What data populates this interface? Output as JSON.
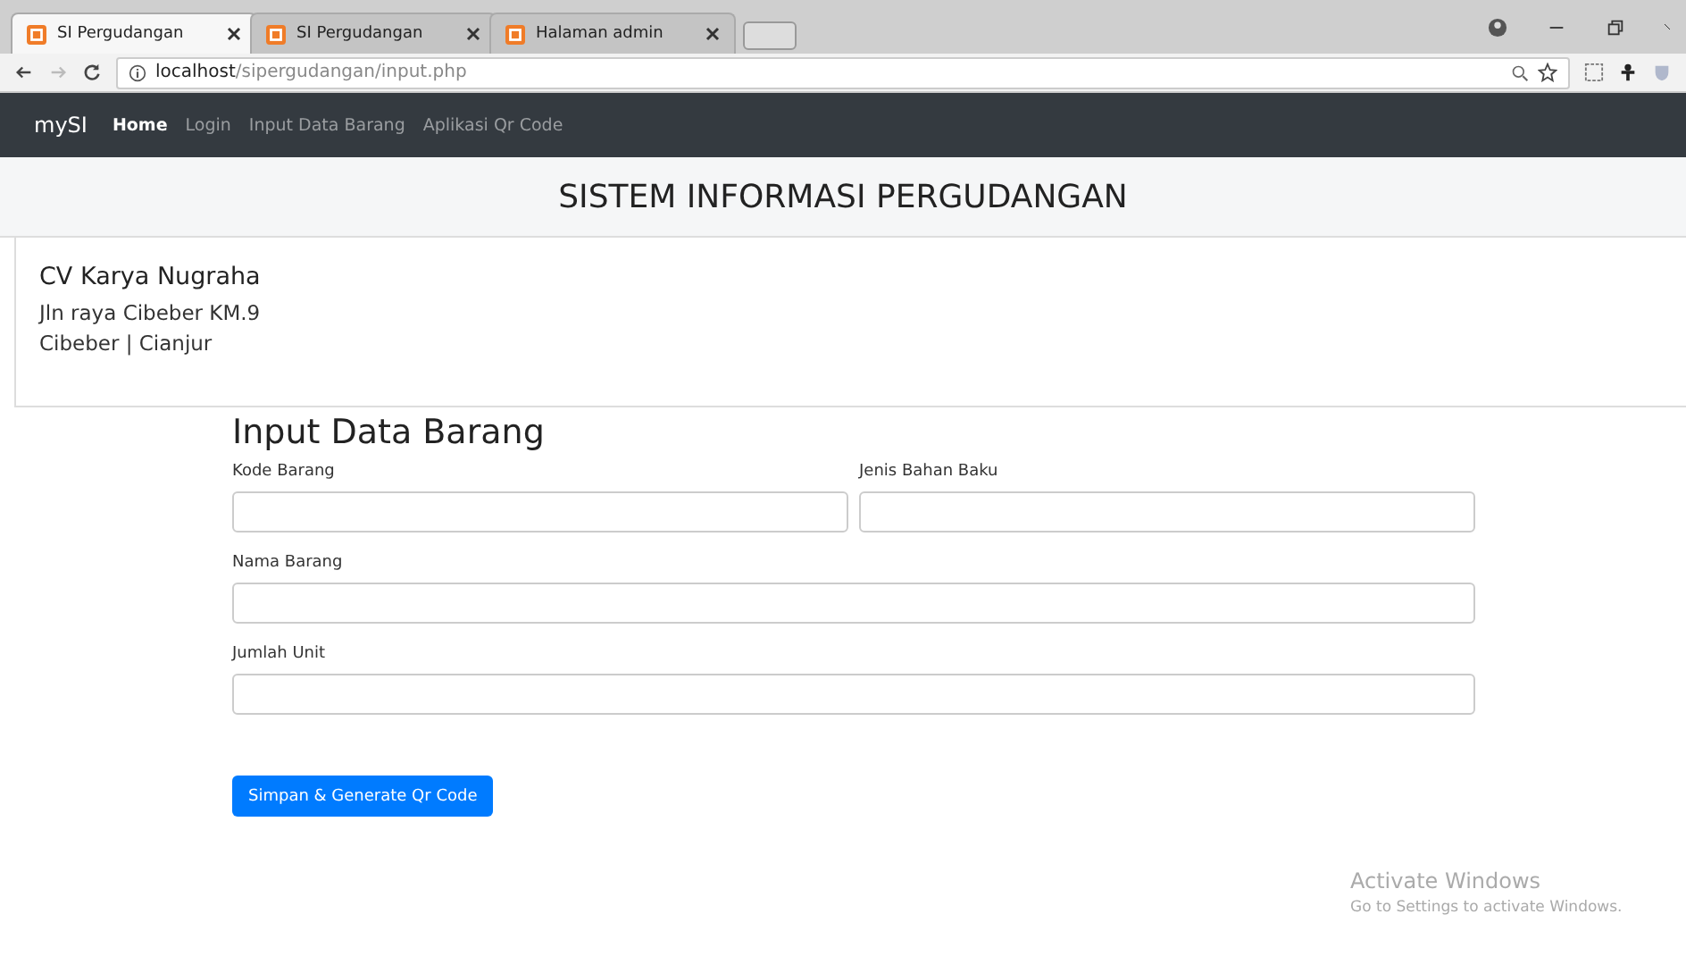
{
  "browser": {
    "tabs": [
      {
        "title": "SI Pergudangan",
        "selected": true
      },
      {
        "title": "SI Pergudangan",
        "selected": false
      },
      {
        "title": "Halaman admin",
        "selected": false
      }
    ],
    "address": {
      "host": "localhost",
      "path": "/sipergudangan/input.php"
    }
  },
  "navbar": {
    "brand": "mySI",
    "links": [
      {
        "label": "Home",
        "selected": true
      },
      {
        "label": "Login",
        "selected": false
      },
      {
        "label": "Input Data Barang",
        "selected": false
      },
      {
        "label": "Aplikasi Qr Code",
        "selected": false
      }
    ]
  },
  "header": {
    "title": "SISTEM INFORMASI PERGUDANGAN"
  },
  "company": {
    "name": "CV Karya Nugraha",
    "lines": [
      "Jln raya Cibeber KM.9",
      "Cibeber | Cianjur"
    ]
  },
  "form": {
    "title": "Input Data Barang",
    "rows": [
      [
        {
          "label": "Kode Barang"
        },
        {
          "label": "Jenis Bahan Baku"
        }
      ],
      [
        {
          "label": "Nama Barang"
        }
      ],
      [
        {
          "label": "Jumlah Unit"
        }
      ]
    ],
    "submit": "Simpan & Generate Qr Code"
  },
  "activation": {
    "title": "Activate Windows",
    "subtitle": "Go to Settings to activate Windows."
  }
}
